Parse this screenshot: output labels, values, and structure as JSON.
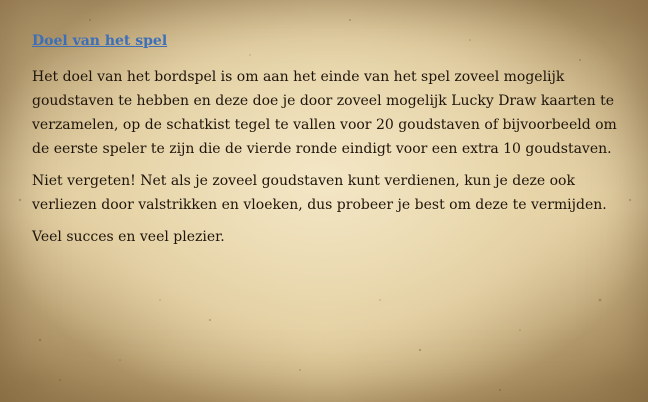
{
  "title_link": "Doel van het spel",
  "paragraphs": [
    "Het doel van het bordspel is om aan het einde van het spel zoveel mogelijk goudstaven te hebben en deze doe je door zoveel mogelijk Lucky Draw kaarten te verzamelen, op de schatkist tegel te vallen voor 20 goudstaven of bijvoorbeeld om de eerste speler te zijn die de vierde ronde eindigt voor een extra 10 goudstaven.",
    "Niet vergeten! Net als je zoveel goudstaven kunt verdienen, kun je deze ook verliezen door valstrikken en vloeken, dus probeer je best om deze te vermijden.",
    "Veel succes en veel plezier."
  ],
  "colors": {
    "link": "#3d6fb8",
    "text": "#1e140a",
    "parchment": "#e6d3a6"
  }
}
